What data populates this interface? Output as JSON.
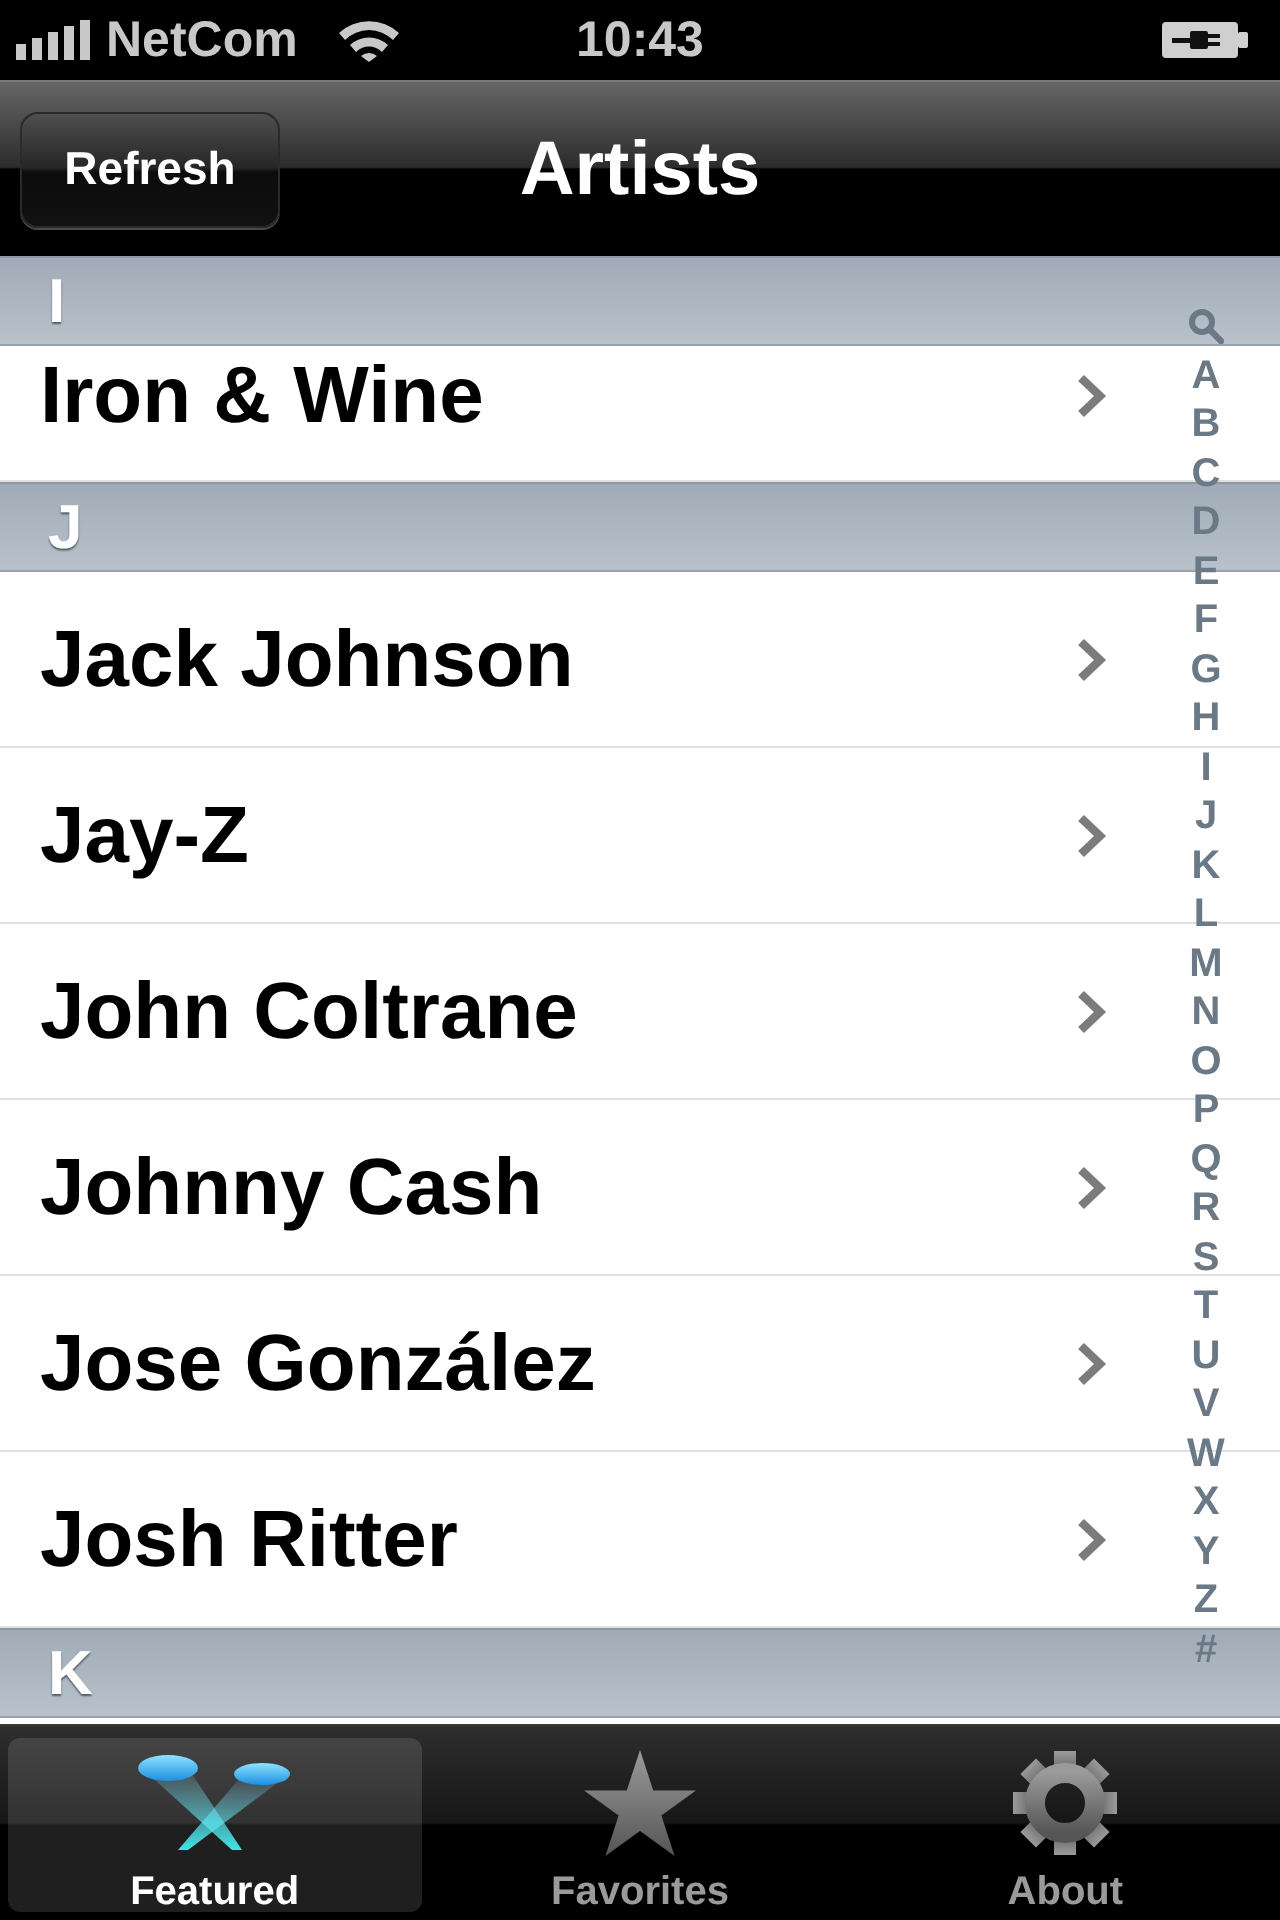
{
  "status_bar": {
    "carrier": "NetCom",
    "time": "10:43"
  },
  "nav_bar": {
    "left_button": "Refresh",
    "title": "Artists"
  },
  "sections": [
    {
      "header": "I",
      "rows": [
        {
          "name": "Iron & Wine"
        }
      ]
    },
    {
      "header": "J",
      "rows": [
        {
          "name": "Jack Johnson"
        },
        {
          "name": "Jay-Z"
        },
        {
          "name": "John Coltrane"
        },
        {
          "name": "Johnny Cash"
        },
        {
          "name": "Jose González"
        },
        {
          "name": "Josh Ritter"
        }
      ]
    },
    {
      "header": "K"
    }
  ],
  "index": [
    "A",
    "B",
    "C",
    "D",
    "E",
    "F",
    "G",
    "H",
    "I",
    "J",
    "K",
    "L",
    "M",
    "N",
    "O",
    "P",
    "Q",
    "R",
    "S",
    "T",
    "U",
    "V",
    "W",
    "X",
    "Y",
    "Z",
    "#"
  ],
  "tabs": [
    {
      "label": "Featured",
      "kind": "featured",
      "selected": true
    },
    {
      "label": "Favorites",
      "kind": "favorites",
      "selected": false
    },
    {
      "label": "About",
      "kind": "about",
      "selected": false
    }
  ]
}
